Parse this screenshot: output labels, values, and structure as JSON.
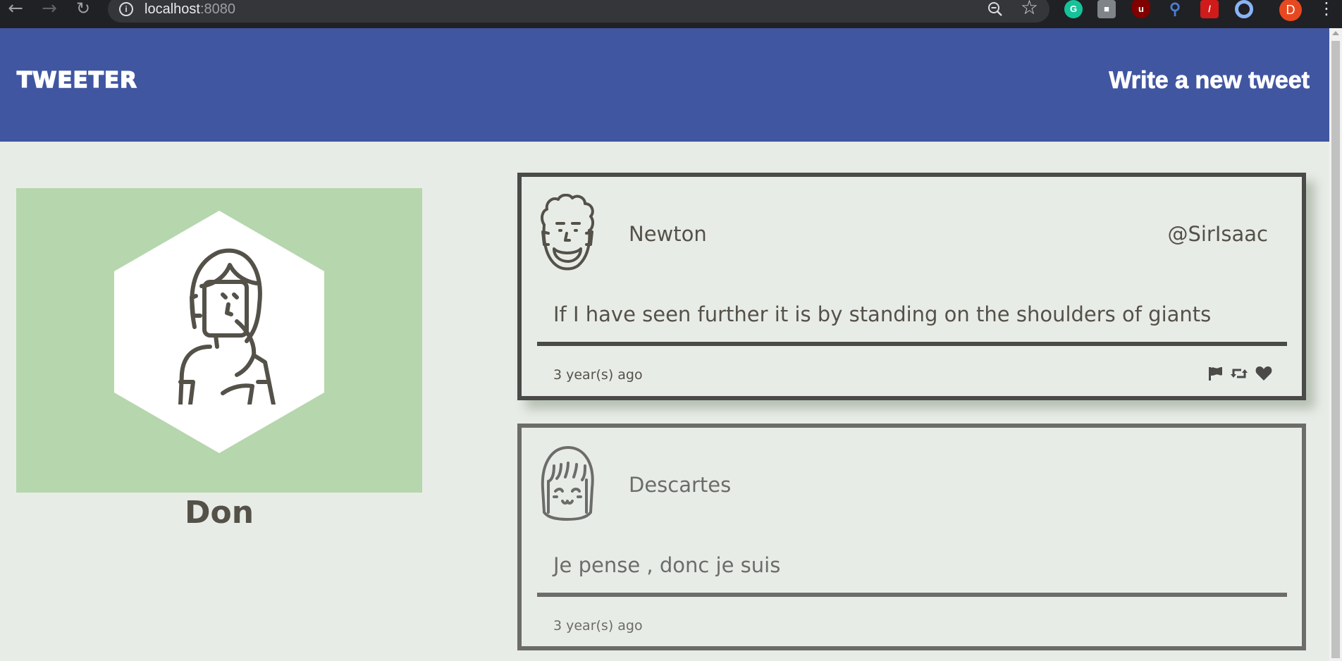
{
  "browser": {
    "url_host": "localhost",
    "url_port": ":8080",
    "profile_initial": "D",
    "extensions": [
      "grammarly-icon",
      "puzzle-extension-icon",
      "ublock-icon",
      "search-extension-icon",
      "pdf-extension-icon",
      "circle-extension-icon"
    ]
  },
  "header": {
    "brand": "TWEETER",
    "compose_label": "Write a new tweet",
    "background": "#4056a1"
  },
  "profile": {
    "name": "Don",
    "card_background": "#b6d6ad"
  },
  "tweets": [
    {
      "name": "Newton",
      "handle": "@SirIsaac",
      "text": "If I have seen further it is by standing on the shoulders of giants",
      "time": "3 year(s) ago",
      "actions": [
        "flag-icon",
        "retweet-icon",
        "heart-icon"
      ]
    },
    {
      "name": "Descartes",
      "handle": "",
      "text": "Je pense , donc je suis",
      "time": "3 year(s) ago",
      "actions": []
    }
  ]
}
